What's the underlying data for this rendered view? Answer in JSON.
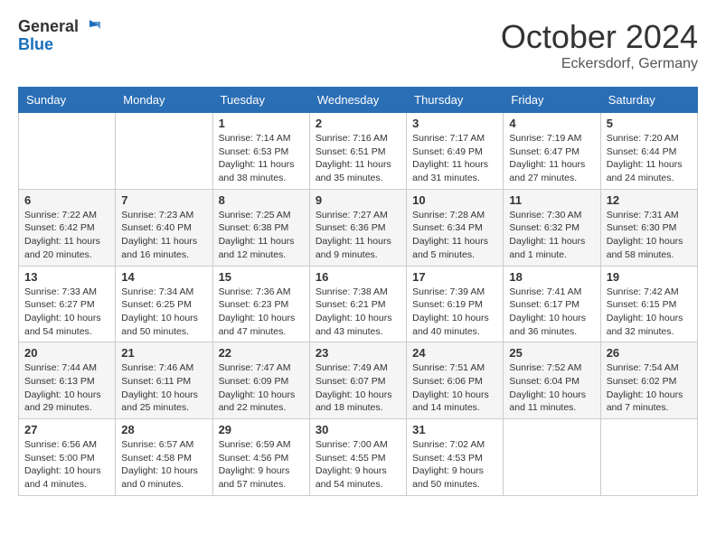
{
  "header": {
    "logo_line1": "General",
    "logo_line2": "Blue",
    "month_title": "October 2024",
    "location": "Eckersdorf, Germany"
  },
  "weekdays": [
    "Sunday",
    "Monday",
    "Tuesday",
    "Wednesday",
    "Thursday",
    "Friday",
    "Saturday"
  ],
  "weeks": [
    [
      {
        "day": "",
        "sunrise": "",
        "sunset": "",
        "daylight": ""
      },
      {
        "day": "",
        "sunrise": "",
        "sunset": "",
        "daylight": ""
      },
      {
        "day": "1",
        "sunrise": "Sunrise: 7:14 AM",
        "sunset": "Sunset: 6:53 PM",
        "daylight": "Daylight: 11 hours and 38 minutes."
      },
      {
        "day": "2",
        "sunrise": "Sunrise: 7:16 AM",
        "sunset": "Sunset: 6:51 PM",
        "daylight": "Daylight: 11 hours and 35 minutes."
      },
      {
        "day": "3",
        "sunrise": "Sunrise: 7:17 AM",
        "sunset": "Sunset: 6:49 PM",
        "daylight": "Daylight: 11 hours and 31 minutes."
      },
      {
        "day": "4",
        "sunrise": "Sunrise: 7:19 AM",
        "sunset": "Sunset: 6:47 PM",
        "daylight": "Daylight: 11 hours and 27 minutes."
      },
      {
        "day": "5",
        "sunrise": "Sunrise: 7:20 AM",
        "sunset": "Sunset: 6:44 PM",
        "daylight": "Daylight: 11 hours and 24 minutes."
      }
    ],
    [
      {
        "day": "6",
        "sunrise": "Sunrise: 7:22 AM",
        "sunset": "Sunset: 6:42 PM",
        "daylight": "Daylight: 11 hours and 20 minutes."
      },
      {
        "day": "7",
        "sunrise": "Sunrise: 7:23 AM",
        "sunset": "Sunset: 6:40 PM",
        "daylight": "Daylight: 11 hours and 16 minutes."
      },
      {
        "day": "8",
        "sunrise": "Sunrise: 7:25 AM",
        "sunset": "Sunset: 6:38 PM",
        "daylight": "Daylight: 11 hours and 12 minutes."
      },
      {
        "day": "9",
        "sunrise": "Sunrise: 7:27 AM",
        "sunset": "Sunset: 6:36 PM",
        "daylight": "Daylight: 11 hours and 9 minutes."
      },
      {
        "day": "10",
        "sunrise": "Sunrise: 7:28 AM",
        "sunset": "Sunset: 6:34 PM",
        "daylight": "Daylight: 11 hours and 5 minutes."
      },
      {
        "day": "11",
        "sunrise": "Sunrise: 7:30 AM",
        "sunset": "Sunset: 6:32 PM",
        "daylight": "Daylight: 11 hours and 1 minute."
      },
      {
        "day": "12",
        "sunrise": "Sunrise: 7:31 AM",
        "sunset": "Sunset: 6:30 PM",
        "daylight": "Daylight: 10 hours and 58 minutes."
      }
    ],
    [
      {
        "day": "13",
        "sunrise": "Sunrise: 7:33 AM",
        "sunset": "Sunset: 6:27 PM",
        "daylight": "Daylight: 10 hours and 54 minutes."
      },
      {
        "day": "14",
        "sunrise": "Sunrise: 7:34 AM",
        "sunset": "Sunset: 6:25 PM",
        "daylight": "Daylight: 10 hours and 50 minutes."
      },
      {
        "day": "15",
        "sunrise": "Sunrise: 7:36 AM",
        "sunset": "Sunset: 6:23 PM",
        "daylight": "Daylight: 10 hours and 47 minutes."
      },
      {
        "day": "16",
        "sunrise": "Sunrise: 7:38 AM",
        "sunset": "Sunset: 6:21 PM",
        "daylight": "Daylight: 10 hours and 43 minutes."
      },
      {
        "day": "17",
        "sunrise": "Sunrise: 7:39 AM",
        "sunset": "Sunset: 6:19 PM",
        "daylight": "Daylight: 10 hours and 40 minutes."
      },
      {
        "day": "18",
        "sunrise": "Sunrise: 7:41 AM",
        "sunset": "Sunset: 6:17 PM",
        "daylight": "Daylight: 10 hours and 36 minutes."
      },
      {
        "day": "19",
        "sunrise": "Sunrise: 7:42 AM",
        "sunset": "Sunset: 6:15 PM",
        "daylight": "Daylight: 10 hours and 32 minutes."
      }
    ],
    [
      {
        "day": "20",
        "sunrise": "Sunrise: 7:44 AM",
        "sunset": "Sunset: 6:13 PM",
        "daylight": "Daylight: 10 hours and 29 minutes."
      },
      {
        "day": "21",
        "sunrise": "Sunrise: 7:46 AM",
        "sunset": "Sunset: 6:11 PM",
        "daylight": "Daylight: 10 hours and 25 minutes."
      },
      {
        "day": "22",
        "sunrise": "Sunrise: 7:47 AM",
        "sunset": "Sunset: 6:09 PM",
        "daylight": "Daylight: 10 hours and 22 minutes."
      },
      {
        "day": "23",
        "sunrise": "Sunrise: 7:49 AM",
        "sunset": "Sunset: 6:07 PM",
        "daylight": "Daylight: 10 hours and 18 minutes."
      },
      {
        "day": "24",
        "sunrise": "Sunrise: 7:51 AM",
        "sunset": "Sunset: 6:06 PM",
        "daylight": "Daylight: 10 hours and 14 minutes."
      },
      {
        "day": "25",
        "sunrise": "Sunrise: 7:52 AM",
        "sunset": "Sunset: 6:04 PM",
        "daylight": "Daylight: 10 hours and 11 minutes."
      },
      {
        "day": "26",
        "sunrise": "Sunrise: 7:54 AM",
        "sunset": "Sunset: 6:02 PM",
        "daylight": "Daylight: 10 hours and 7 minutes."
      }
    ],
    [
      {
        "day": "27",
        "sunrise": "Sunrise: 6:56 AM",
        "sunset": "Sunset: 5:00 PM",
        "daylight": "Daylight: 10 hours and 4 minutes."
      },
      {
        "day": "28",
        "sunrise": "Sunrise: 6:57 AM",
        "sunset": "Sunset: 4:58 PM",
        "daylight": "Daylight: 10 hours and 0 minutes."
      },
      {
        "day": "29",
        "sunrise": "Sunrise: 6:59 AM",
        "sunset": "Sunset: 4:56 PM",
        "daylight": "Daylight: 9 hours and 57 minutes."
      },
      {
        "day": "30",
        "sunrise": "Sunrise: 7:00 AM",
        "sunset": "Sunset: 4:55 PM",
        "daylight": "Daylight: 9 hours and 54 minutes."
      },
      {
        "day": "31",
        "sunrise": "Sunrise: 7:02 AM",
        "sunset": "Sunset: 4:53 PM",
        "daylight": "Daylight: 9 hours and 50 minutes."
      },
      {
        "day": "",
        "sunrise": "",
        "sunset": "",
        "daylight": ""
      },
      {
        "day": "",
        "sunrise": "",
        "sunset": "",
        "daylight": ""
      }
    ]
  ]
}
